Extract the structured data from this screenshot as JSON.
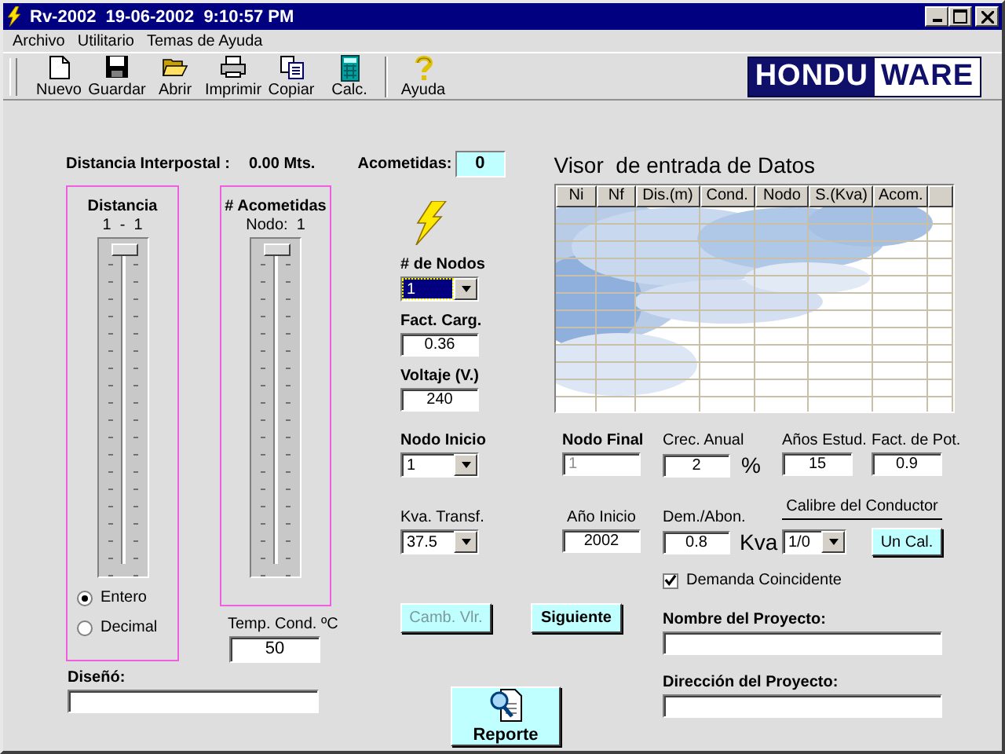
{
  "window": {
    "title": "Rv-2002  19-06-2002  9:10:57 PM"
  },
  "menu": [
    {
      "label": "Archivo"
    },
    {
      "label": "Utilitario"
    },
    {
      "label": "Temas de Ayuda"
    }
  ],
  "toolbar": [
    {
      "label": "Nuevo",
      "kind": "new",
      "separator_before": false
    },
    {
      "label": "Guardar",
      "kind": "save",
      "separator_before": false
    },
    {
      "label": "Abrir",
      "kind": "open",
      "separator_before": false
    },
    {
      "label": "Imprimir",
      "kind": "print",
      "separator_before": false
    },
    {
      "label": "Copiar",
      "kind": "copy",
      "separator_before": false
    },
    {
      "label": "Calc.",
      "kind": "calc",
      "separator_before": false
    },
    {
      "label": "Ayuda",
      "kind": "help",
      "separator_before": true
    }
  ],
  "logo": {
    "left": "HONDU",
    "right": "WARE"
  },
  "distance": {
    "label": "Distancia Interpostal :",
    "value": "0.00 Mts."
  },
  "acometidas": {
    "label": "Acometidas:",
    "value": "0"
  },
  "viewer": {
    "title": "Visor  de entrada de Datos",
    "columns": [
      "Ni",
      "Nf",
      "Dis.(m)",
      "Cond.",
      "Nodo",
      "S.(Kva)",
      "Acom."
    ]
  },
  "sliders": [
    {
      "title": "Distancia",
      "caption": "1  -  1",
      "level": 0
    },
    {
      "title": "# Acometidas",
      "caption": "Nodo:  1",
      "level": 0
    }
  ],
  "mode": [
    {
      "label": "Entero",
      "selected": true
    },
    {
      "label": "Decimal",
      "selected": false
    }
  ],
  "temp": {
    "label": "Temp. Cond. ºC",
    "value": "50"
  },
  "designer": {
    "label": "Diseñó:"
  },
  "nodes": {
    "label": "# de Nodos",
    "value": "1",
    "focused": true
  },
  "load_factor": {
    "label": "Fact. Carg.",
    "value": "0.36"
  },
  "voltage": {
    "label": "Voltaje (V.)",
    "value": "240"
  },
  "start_node": {
    "label": "Nodo Inicio",
    "value": "1"
  },
  "end_node": {
    "label": "Nodo Final",
    "value": "1",
    "disabled": true
  },
  "growth": {
    "label": "Crec. Anual",
    "value": "2",
    "unit": "%"
  },
  "years": {
    "label": "Años Estud.",
    "value": "15"
  },
  "power_factor": {
    "label": "Fact. de Pot.",
    "value": "0.9"
  },
  "transformer": {
    "label": "Kva. Transf.",
    "value": "37.5"
  },
  "start_year": {
    "label": "Año Inicio",
    "value": "2002"
  },
  "demand": {
    "label": "Dem./Abon.",
    "value": "0.8",
    "unit": "Kva"
  },
  "conductor": {
    "label": "Calibre del Conductor",
    "value": "1/0",
    "button": "Un Cal."
  },
  "coincident": {
    "label": "Demanda Coincidente",
    "checked": true
  },
  "buttons": {
    "change": {
      "label": "Camb. Vlr.",
      "disabled": true
    },
    "next": {
      "label": "Siguiente",
      "disabled": false
    },
    "report": {
      "label": "Reporte"
    }
  },
  "project_name": {
    "label": "Nombre del Proyecto:"
  },
  "project_address": {
    "label": "Dirección del Proyecto:"
  }
}
